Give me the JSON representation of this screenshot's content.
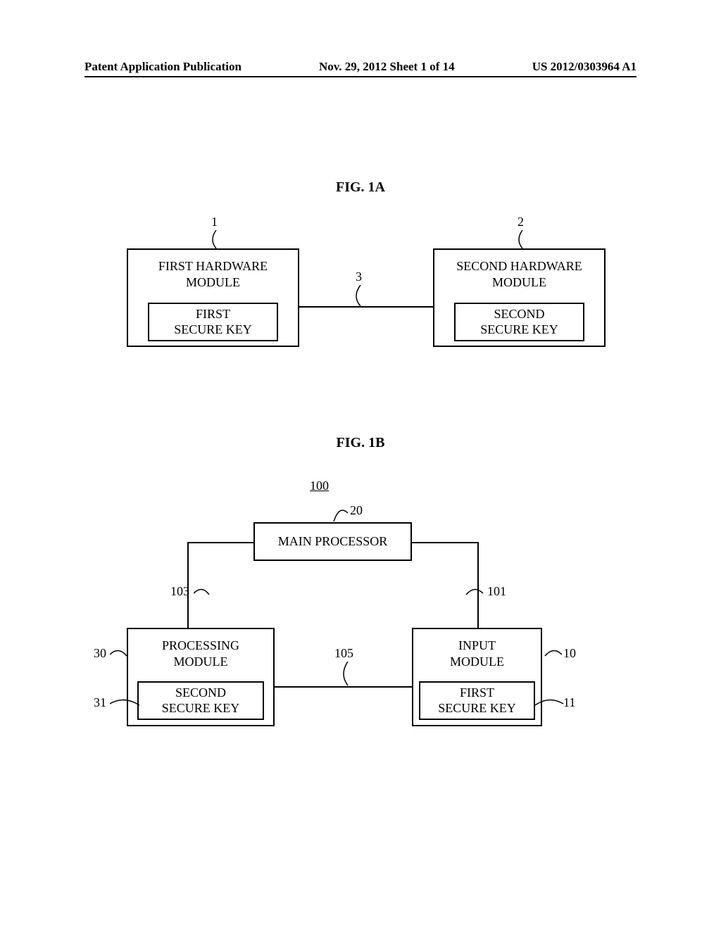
{
  "header": {
    "left": "Patent Application Publication",
    "center": "Nov. 29, 2012  Sheet 1 of 14",
    "right": "US 2012/0303964 A1"
  },
  "fig1a": {
    "label": "FIG. 1A",
    "box1": {
      "title": "FIRST HARDWARE\nMODULE",
      "inner": "FIRST\nSECURE KEY",
      "ref": "1"
    },
    "box2": {
      "title": "SECOND HARDWARE\nMODULE",
      "inner": "SECOND\nSECURE KEY",
      "ref": "2"
    },
    "conn_ref": "3"
  },
  "fig1b": {
    "label": "FIG. 1B",
    "sys_ref": "100",
    "main_proc": {
      "label": "MAIN PROCESSOR",
      "ref": "20"
    },
    "proc_mod": {
      "title": "PROCESSING\nMODULE",
      "inner": "SECOND\nSECURE KEY",
      "ref": "30",
      "inner_ref": "31"
    },
    "input_mod": {
      "title": "INPUT\nMODULE",
      "inner": "FIRST\nSECURE KEY",
      "ref": "10",
      "inner_ref": "11"
    },
    "conn_left_ref": "103",
    "conn_right_ref": "101",
    "conn_bottom_ref": "105"
  }
}
